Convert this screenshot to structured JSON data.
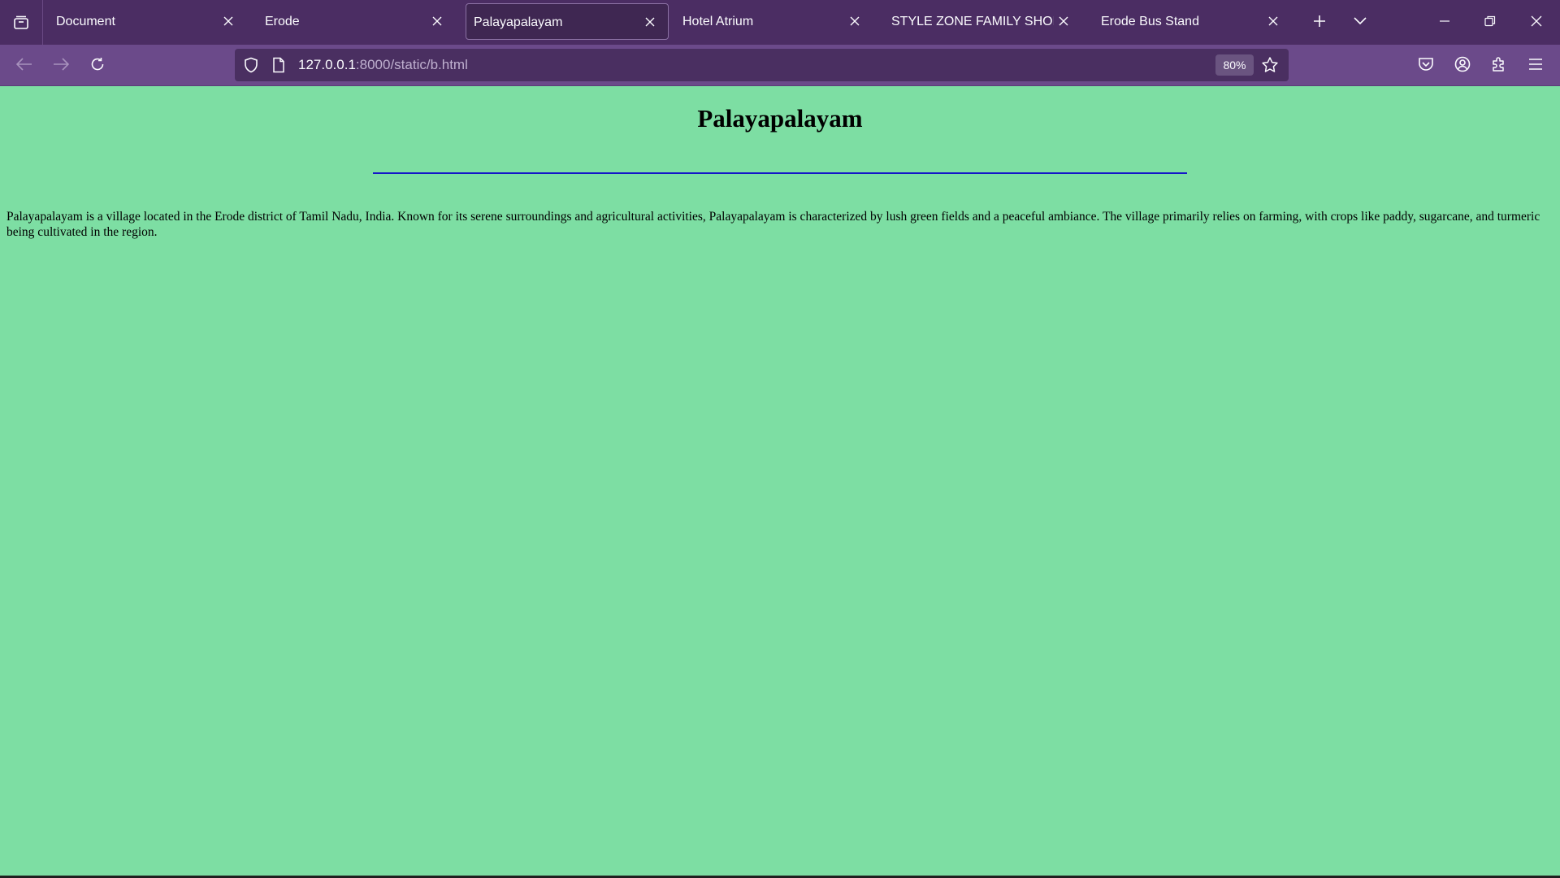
{
  "browser": {
    "tabs": [
      {
        "label": "Document",
        "active": false
      },
      {
        "label": "Erode",
        "active": false
      },
      {
        "label": "Palayapalayam",
        "active": true
      },
      {
        "label": "Hotel Atrium",
        "active": false
      },
      {
        "label": "STYLE ZONE FAMILY SHOP",
        "active": false
      },
      {
        "label": "Erode Bus Stand",
        "active": false
      }
    ],
    "url_host": "127.0.0.1",
    "url_rest": ":8000/static/b.html",
    "zoom": "80%",
    "colors": {
      "tabstrip": "#4b2d63",
      "navbar": "#6b4a8a",
      "urlbar": "#4a2f61"
    },
    "icons": [
      "tab-list-icon",
      "close-icon",
      "plus-icon",
      "chevron-down-icon",
      "minimize-icon",
      "restore-icon",
      "window-close-icon",
      "back-arrow-icon",
      "forward-arrow-icon",
      "reload-icon",
      "shield-icon",
      "page-icon",
      "star-icon",
      "pocket-icon",
      "account-icon",
      "extensions-icon",
      "menu-icon"
    ]
  },
  "page": {
    "title": "Palayapalayam",
    "paragraph": "Palayapalayam is a village located in the Erode district of Tamil Nadu, India. Known for its serene surroundings and agricultural activities, Palayapalayam is characterized by lush green fields and a peaceful ambiance. The village primarily relies on farming, with crops like paddy, sugarcane, and turmeric being cultivated in the region.",
    "background_color": "#7ddea3",
    "rule_color": "#1515c8"
  }
}
